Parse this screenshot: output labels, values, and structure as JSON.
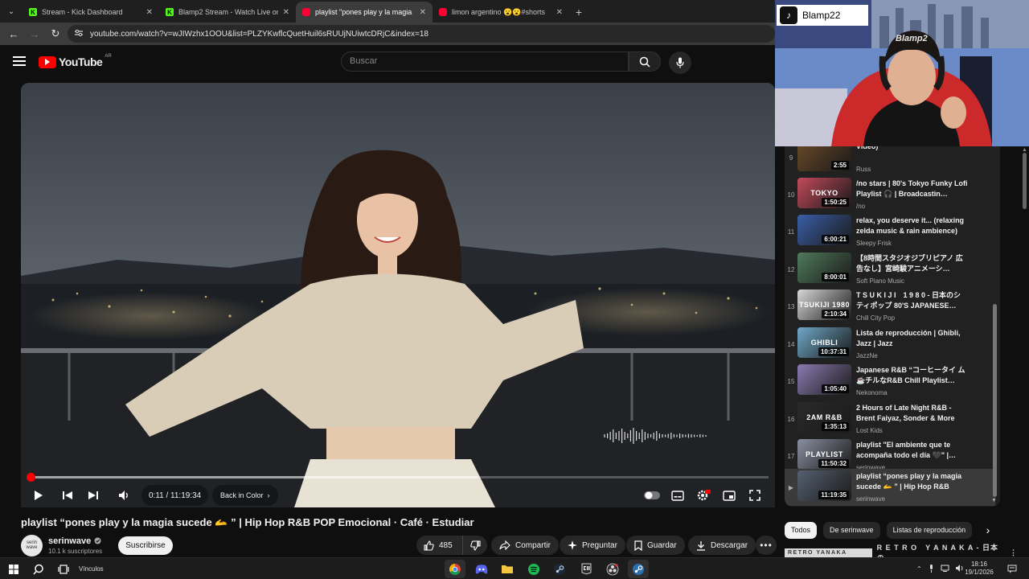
{
  "browser": {
    "tabs": [
      {
        "title": "Stream - Kick Dashboard",
        "icon": "kick-icon",
        "active": false
      },
      {
        "title": "Blamp2 Stream - Watch Live on",
        "icon": "kick-icon",
        "active": false
      },
      {
        "title": "playlist \"pones play y la magia",
        "icon": "youtube-icon",
        "active": true
      },
      {
        "title": "limon argentino 😮😮#shorts",
        "icon": "youtube-icon",
        "active": false
      }
    ],
    "url": "youtube.com/watch?v=wJIWzhx1OOU&list=PLZYKwflcQuetHuil6sRUUjNUiwtcDRjC&index=18"
  },
  "youtube": {
    "logo_text": "YouTube",
    "region": "AR",
    "search_placeholder": "Buscar"
  },
  "player": {
    "time": "0:11 / 11:19:34",
    "chapter": "Back in Color",
    "progress": 0.0003
  },
  "video": {
    "title": "playlist “pones play y la magia sucede 🫴 ” | Hip Hop R&B POP Emocional · Café · Estudiar",
    "channel": "serinwave",
    "channel_avatar": "serin wave",
    "subscribers": "10.1 k suscriptores",
    "subscribe_label": "Suscribirse",
    "likes": "485",
    "share_label": "Compartir",
    "ask_label": "Preguntar",
    "save_label": "Guardar",
    "download_label": "Descargar"
  },
  "overlay": {
    "streamer_name": "Blamp22",
    "banner_text": "Blamp2"
  },
  "playlist": {
    "items": [
      {
        "index": "9",
        "title": "Video)",
        "channel": "Russ",
        "duration": "2:55",
        "color": "#6a4a2a"
      },
      {
        "index": "10",
        "title": "/no stars | 80's Tokyo Funky Lofi Playlist 🎧 | Broadcastin…",
        "channel": "/no",
        "duration": "1:50:25",
        "color": "#c24a5a",
        "thumb_text": "TOKYO"
      },
      {
        "index": "11",
        "title": "relax, you deserve it... (relaxing zelda music & rain ambience)",
        "channel": "Sleepy Frisk",
        "duration": "6:00:21",
        "color": "#3a5ea8"
      },
      {
        "index": "12",
        "title": "【8時間スタジオジブリピアノ 広告なし】宮崎駿アニメーシ…",
        "channel": "Soft Piano Music",
        "duration": "8:00:01",
        "color": "#4f7a5a"
      },
      {
        "index": "13",
        "title": "T S U K I J I　1 9 8 0 - 日本のシ ティポップ 80'S JAPANESE…",
        "channel": "Chill City Pop",
        "duration": "2:10:34",
        "color": "#d8d8d8",
        "thumb_text": "TSUKIJI 1980"
      },
      {
        "index": "14",
        "title": "Lista de reproducción | Ghibli, Jazz | Jazz",
        "channel": "JazzNe",
        "duration": "10:37:31",
        "color": "#6fa8c8",
        "thumb_text": "GHIBLI"
      },
      {
        "index": "15",
        "title": "Japanese R&B “コーヒータイ ム☕チルなR&B Chill Playlist…",
        "channel": "Nekonoma",
        "duration": "1:05:40",
        "color": "#8a7ab0"
      },
      {
        "index": "16",
        "title": "2 Hours of Late Night R&B - Brent Faiyaz, Sonder & More",
        "channel": "Lost Kids",
        "duration": "1:35:13",
        "color": "#2a2a2a",
        "thumb_text": "2AM R&B"
      },
      {
        "index": "17",
        "title": "playlist \"El ambiente que te acompaña todo el día 🖤\" |…",
        "channel": "serinwave",
        "duration": "11:50:32",
        "color": "#8a8fa0",
        "thumb_text": "PLAYLIST"
      },
      {
        "index": "▶",
        "title": "playlist “pones play y la magia sucede 🫴 ” | Hip Hop R&B PO…",
        "channel": "serinwave",
        "duration": "11:19:35",
        "color": "#556070",
        "active": true
      }
    ]
  },
  "chips": [
    "Todos",
    "De serinwave",
    "Listas de reproducción"
  ],
  "related_preview": {
    "thumb_text": "RETRO YANAKA",
    "title": "R E T R O　Y A N A K A - 日本の"
  },
  "taskbar": {
    "vinculos_label": "Vínculos",
    "time": "18:16",
    "date": "19/1/2026"
  },
  "colors": {
    "accent_red": "#ff0000",
    "bg": "#0f0f0f",
    "kick_green": "#53fc18"
  }
}
